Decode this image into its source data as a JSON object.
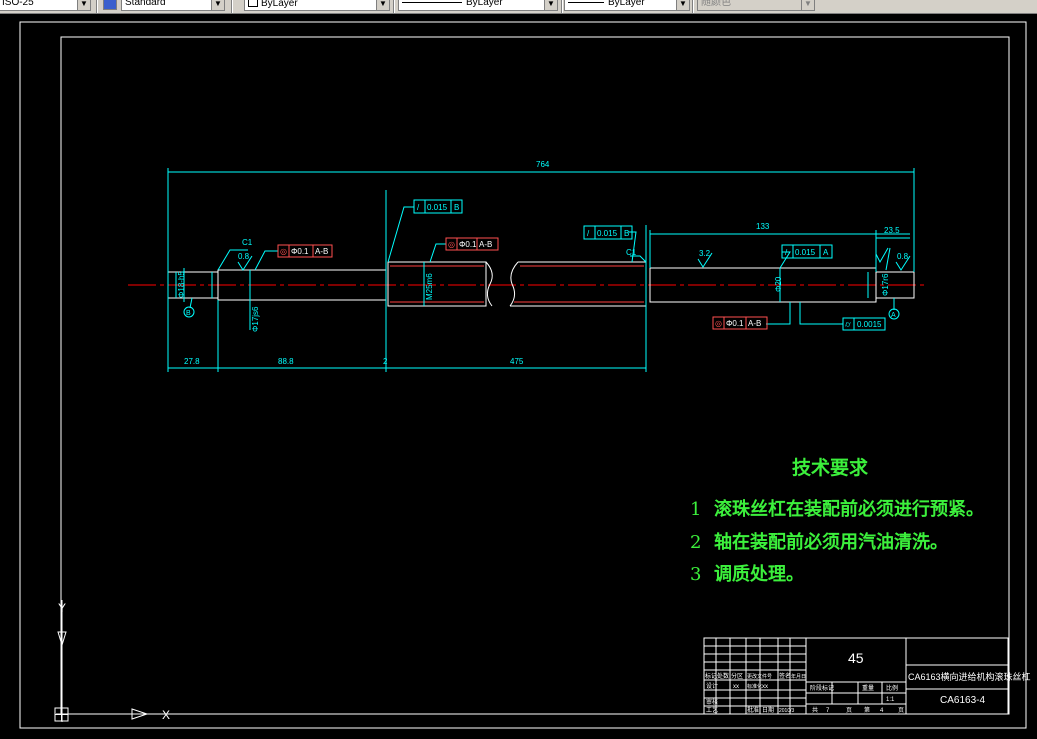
{
  "toolbar": {
    "dimstyle": "ISO-25",
    "textstyle": "Standard",
    "layer_color": "ByLayer",
    "linetype": "ByLayer",
    "lineweight": "ByLayer",
    "plotstyle": "随颜色"
  },
  "colors": {
    "cad_background": "#000000",
    "dimension": "#00ffff",
    "border": "#ffffff",
    "centerline": "#ff0000",
    "tolerance_symbol": "#ff5050",
    "tech_text": "#3cf03c"
  },
  "dimensions": {
    "overall_length": "764",
    "seg_133": "133",
    "seg_23_5": "23.5",
    "seg_27_8": "27.8",
    "seg_88_8": "88.8",
    "seg_2": "2",
    "seg_475": "475",
    "dia_left": "Φ18-h5",
    "dia_17js6": "Φ17js6",
    "thread": "M25m6",
    "dia_20": "Φ20",
    "dia_17r6": "Φ17r6",
    "chamfer_c1_left": "C1",
    "chamfer_c1_right": "C1",
    "rough_0_8_a": "0.8",
    "rough_0_8_b": "0.8",
    "rough_3_2": "3.2"
  },
  "tolerances": {
    "fcf1_sym": "/",
    "fcf1_val": "0.015",
    "fcf1_ref": "B",
    "fcf2_sym": "◎",
    "fcf2_val": "Φ0.1",
    "fcf2_ref": "A-B",
    "fcf3_sym": "◎",
    "fcf3_val": "Φ0.1",
    "fcf3_ref": "A-B",
    "fcf4_sym": "/",
    "fcf4_val": "0.015",
    "fcf4_ref": "B",
    "fcf5_sym": "/",
    "fcf5_val": "0.015",
    "fcf5_ref": "A",
    "fcf6_sym": "◎",
    "fcf6_val": "Φ0.1",
    "fcf6_ref": "A-B",
    "fcf7_sym": "⌭",
    "fcf7_val": "0.0015",
    "datum_a": "A",
    "datum_b": "B"
  },
  "tech_requirements": {
    "title": "技术要求",
    "items": [
      {
        "num": "1",
        "text": "滚珠丝杠在装配前必须进行预紧。"
      },
      {
        "num": "2",
        "text": "轴在装配前必须用汽油清洗。"
      },
      {
        "num": "3",
        "text": "调质处理。"
      }
    ]
  },
  "title_block": {
    "material": "45",
    "part_name": "CA6163横向进给机构滚珠丝杠",
    "drawing_no": "CA6163-4",
    "scale": "1:1",
    "stage_label": "阶段标记",
    "weight_label": "重量",
    "scale_label": "比例",
    "total_label": "共",
    "total": "7",
    "sheet_label": "第",
    "sheet": "4",
    "page_label": "页",
    "date": "2010/3",
    "date_label": "日期",
    "mark_label": "标记",
    "qty_label": "处数",
    "zone_label": "分区",
    "change_doc_label": "更改文件号",
    "sign_label": "签名",
    "date_col_label": "年月日",
    "design_label": "设计",
    "review_label": "审核",
    "process_label": "工艺",
    "std_label": "标准化",
    "approve_label": "批准",
    "designer": "xx",
    "std_sign": "xx"
  },
  "ucs": {
    "x_label": "X",
    "y_label": "Y"
  }
}
